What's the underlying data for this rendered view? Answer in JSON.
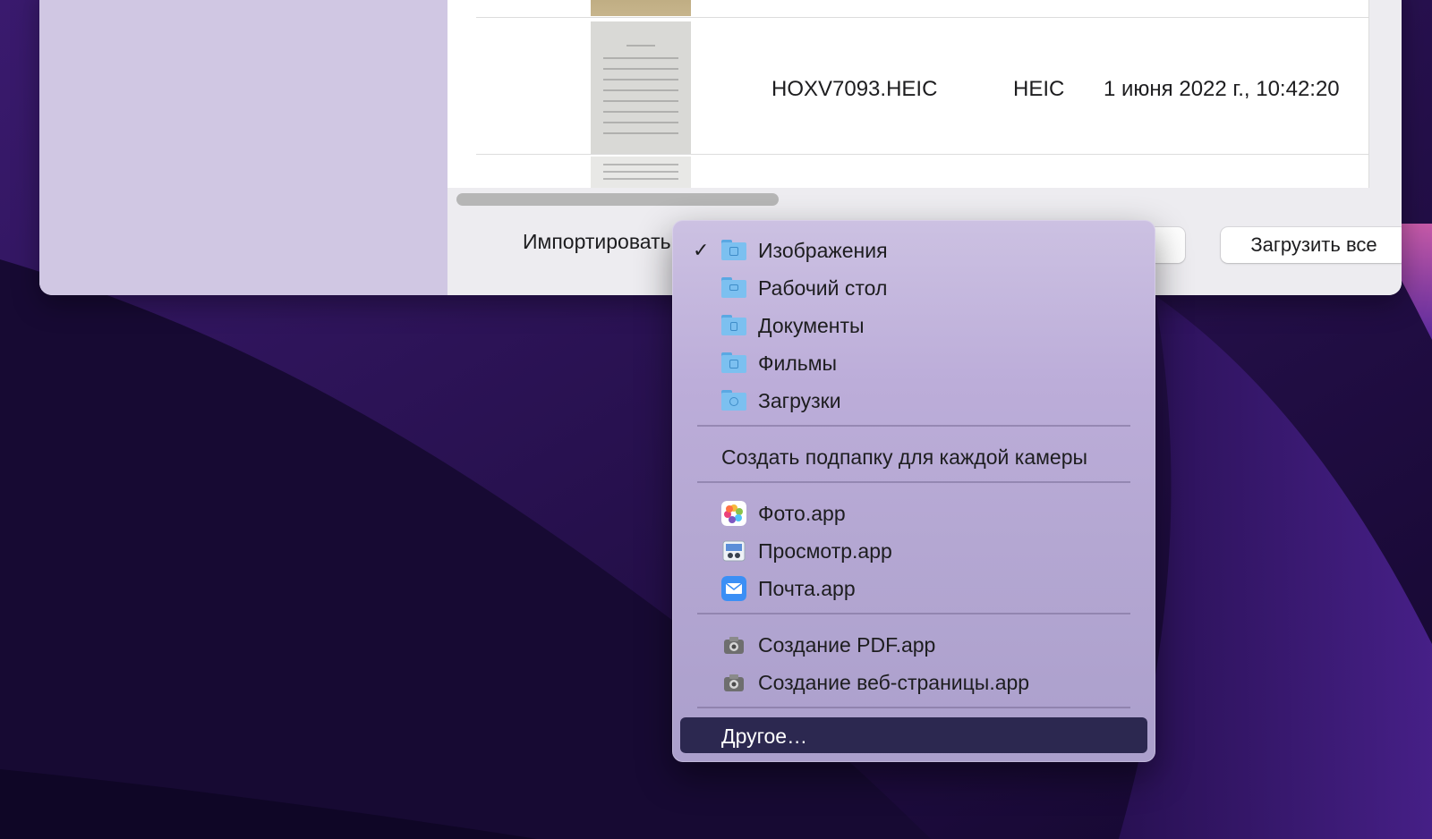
{
  "table": {
    "rows": [
      {
        "name": "",
        "kind": "",
        "date": ""
      },
      {
        "name": "HOXV7093.HEIC",
        "kind": "HEIC",
        "date": "1 июня 2022 г., 10:42:20"
      },
      {
        "name": "",
        "kind": "",
        "date": ""
      }
    ]
  },
  "import": {
    "label": "Импортировать в",
    "load_all_button": "Загрузить все"
  },
  "menu": {
    "folders": [
      {
        "label": "Изображения",
        "checked": true,
        "icon": "pictures-folder-icon"
      },
      {
        "label": "Рабочий стол",
        "checked": false,
        "icon": "desktop-folder-icon"
      },
      {
        "label": "Документы",
        "checked": false,
        "icon": "documents-folder-icon"
      },
      {
        "label": "Фильмы",
        "checked": false,
        "icon": "movies-folder-icon"
      },
      {
        "label": "Загрузки",
        "checked": false,
        "icon": "downloads-folder-icon"
      }
    ],
    "subfolder_option": "Создать подпапку для каждой камеры",
    "apps": [
      {
        "label": "Фото.app",
        "icon": "photos-app-icon"
      },
      {
        "label": "Просмотр.app",
        "icon": "preview-app-icon"
      },
      {
        "label": "Почта.app",
        "icon": "mail-app-icon"
      }
    ],
    "automator": [
      {
        "label": "Создание PDF.app",
        "icon": "automator-icon"
      },
      {
        "label": "Создание веб-страницы.app",
        "icon": "automator-icon"
      }
    ],
    "other": "Другое…",
    "check_glyph": "✓"
  },
  "colors": {
    "menu_selection": "#2c2850",
    "sidebar": "#d0c7e3",
    "desktop": "#1b0c3c"
  }
}
